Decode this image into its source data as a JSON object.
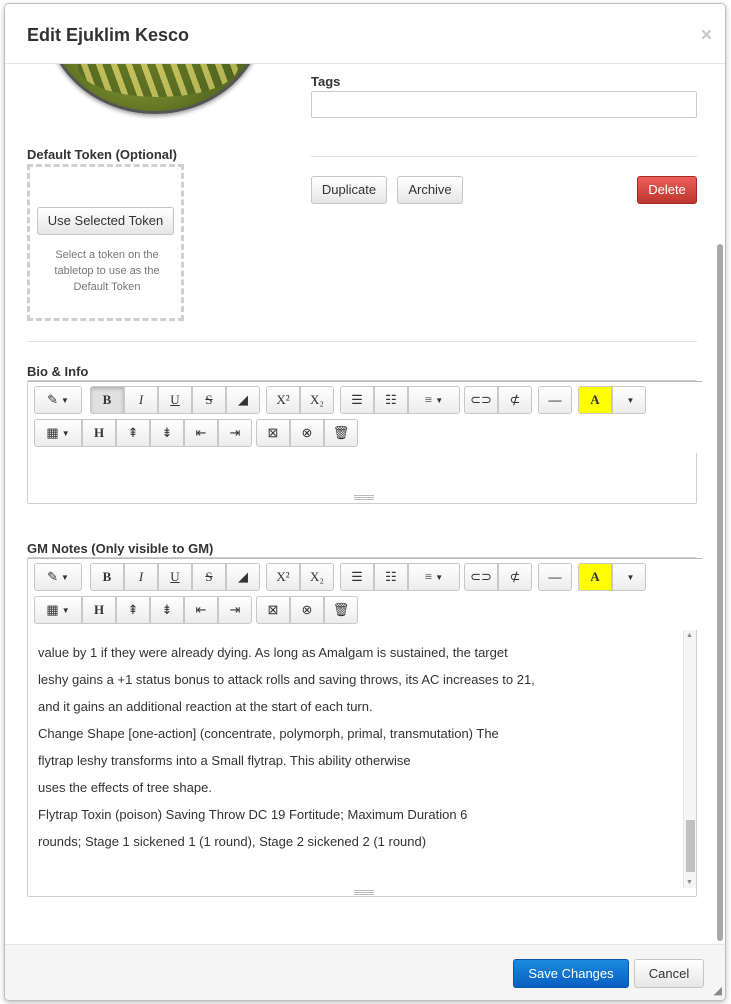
{
  "dialog": {
    "title": "Edit Ejuklim Kesco",
    "close_label": "×"
  },
  "tags": {
    "label": "Tags",
    "value": ""
  },
  "actions": {
    "duplicate": "Duplicate",
    "archive": "Archive",
    "delete": "Delete"
  },
  "token": {
    "label": "Default Token (Optional)",
    "use_button": "Use Selected Token",
    "help_text": "Select a token on the tabletop to use as the Default Token"
  },
  "bio": {
    "label": "Bio & Info",
    "content": ""
  },
  "gm_notes": {
    "label": "GM Notes (Only visible to GM)",
    "lines": [
      "value by 1 if they were already dying. As long as Amalgam is sustained, the target",
      "leshy gains a +1 status bonus to attack rolls and saving throws, its AC increases to 21,",
      "and it gains an additional reaction at the start of each turn.",
      "Change Shape [one-action] (concentrate, polymorph, primal, transmutation) The",
      "flytrap leshy transforms into a Small flytrap. This ability otherwise",
      "uses the effects of tree shape.",
      "Flytrap Toxin (poison) Saving Throw DC 19 Fortitude; Maximum Duration 6",
      "rounds; Stage 1 sickened 1 (1 round), Stage 2 sickened 2 (1 round)"
    ]
  },
  "toolbar": {
    "bold": "B",
    "italic": "I",
    "underline": "U",
    "strike": "S",
    "superscript": "X²",
    "subscript": "X₂",
    "highlight": "A",
    "header": "H"
  },
  "footer": {
    "save": "Save Changes",
    "cancel": "Cancel"
  },
  "colors": {
    "primary": "#0a6fd6",
    "danger": "#d9423c",
    "highlight_yellow": "#ffff00"
  }
}
